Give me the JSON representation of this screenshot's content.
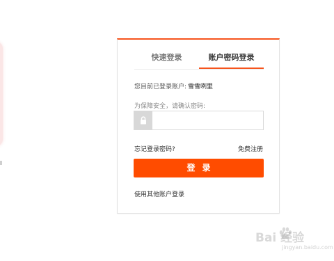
{
  "tabs": {
    "quick": "快速登录",
    "password": "账户密码登录"
  },
  "account": {
    "prefix": "您目前已登录账户:",
    "name": "雪雪咧里"
  },
  "password_field": {
    "label": "为保障安全，请确认密码:",
    "value": "",
    "placeholder": ""
  },
  "links": {
    "forgot": "忘记登录密码?",
    "register": "免费注册",
    "other": "使用其他账户登录"
  },
  "login_button": {
    "label": "登录"
  },
  "watermark": {
    "logo_text": "Bai  经验",
    "sub": "jingyan.baidu.com"
  },
  "colors": {
    "accent": "#ff4c00",
    "tab_underline": "#f6541c",
    "lock_bg": "#d8d8d8"
  },
  "icons": {
    "lock": "lock-icon",
    "paw": "baidu-paw-icon"
  }
}
